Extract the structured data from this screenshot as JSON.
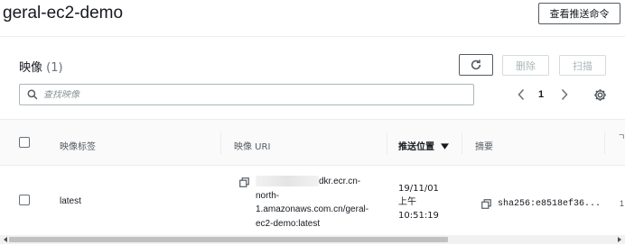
{
  "header": {
    "repo_title": "geral-ec2-demo",
    "view_push_commands_label": "查看推送命令"
  },
  "images_panel": {
    "title": "映像",
    "count": "(1)",
    "refresh_icon": "refresh-icon",
    "delete_label": "删除",
    "scan_label": "扫描",
    "search_placeholder": "查找映像",
    "search_value": "",
    "pagination": {
      "current_page": "1"
    }
  },
  "table": {
    "columns": [
      {
        "label": "映像标签"
      },
      {
        "label": "映像 URI"
      },
      {
        "label": "推送位置",
        "sorted": "descending"
      },
      {
        "label": "摘要"
      }
    ],
    "rows": [
      {
        "tag": "latest",
        "uri_lines": [
          "dkr.ecr.cn-",
          "north-",
          "1.amazonaws.com.cn/geral-",
          "ec2-demo:latest"
        ],
        "pushed_lines": [
          "19/11/01",
          "上午",
          "10:51:19"
        ],
        "digest": "sha256:e8518ef36..."
      }
    ]
  },
  "edge_chars": {
    "header_right": "ㄱ",
    "row_right": "1"
  },
  "colors": {
    "border": "#545b64",
    "disabled": "#aab7b8",
    "header_bg": "#fafafa"
  }
}
